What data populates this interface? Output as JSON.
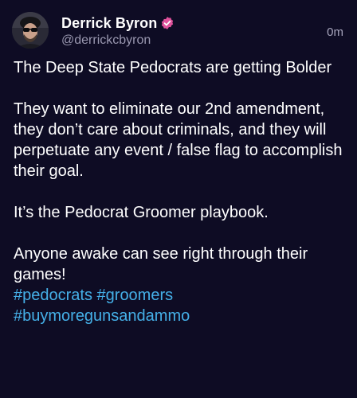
{
  "post": {
    "author": {
      "display_name": "Derrick Byron",
      "handle": "@derrickcbyron",
      "verified_badge_color": "#e0529c",
      "avatar_icon": "avatar-photo"
    },
    "timestamp": "0m",
    "paragraphs": [
      "The Deep State Pedocrats are getting Bolder",
      "They want to eliminate our 2nd amendment, they don’t care about criminals, and they will perpetuate any event / false flag to accomplish their goal.",
      "It’s the Pedocrat Groomer playbook.",
      "Anyone awake can see right through their games!"
    ],
    "hashtags": [
      "#pedocrats",
      "#groomers",
      "#buymoregunsandammo"
    ]
  },
  "colors": {
    "background": "#0e0c24",
    "text": "#ffffff",
    "secondary_text": "#9a98b0",
    "link": "#45b0e8"
  }
}
